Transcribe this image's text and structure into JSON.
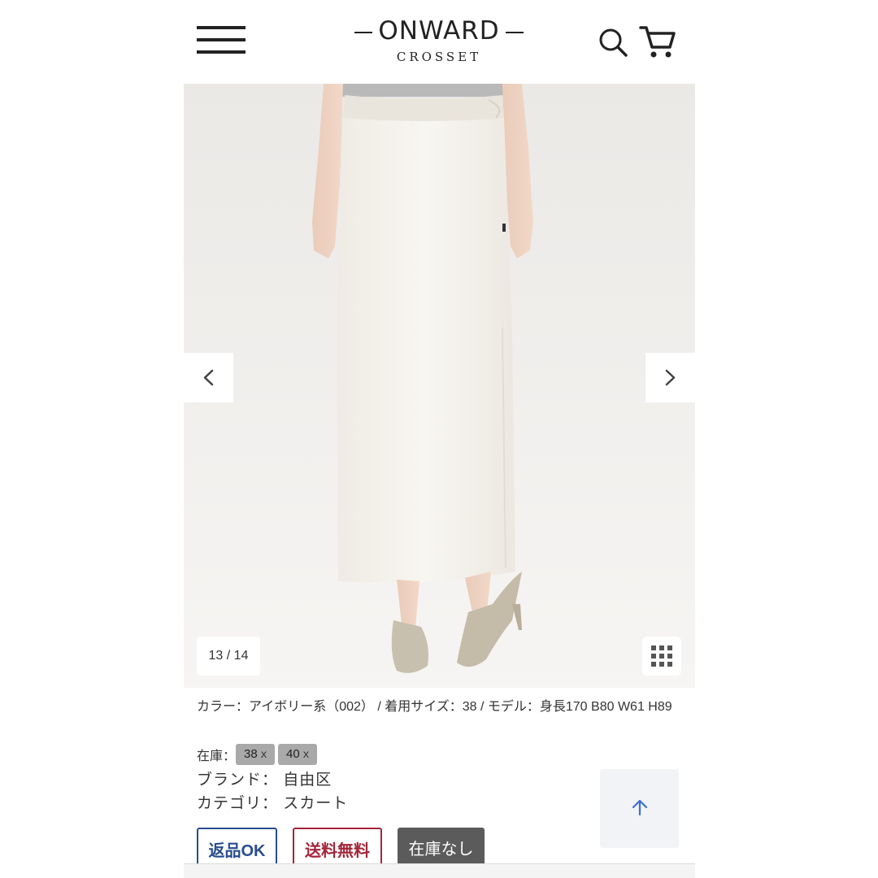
{
  "header": {
    "logo_main": "ONWARD",
    "logo_sub": "CROSSET",
    "menu_icon": "hamburger-menu-icon",
    "search_icon": "search-icon",
    "cart_icon": "cart-icon"
  },
  "gallery": {
    "counter": "13 / 14",
    "prev_icon": "chevron-left-icon",
    "next_icon": "chevron-right-icon",
    "grid_icon": "grid-icon",
    "image_desc": "product-photo"
  },
  "product": {
    "color_info": "カラー：アイボリー系（002）  /  着用サイズ：38  /  モデル：身長170 B80 W61 H89",
    "stock_label": "在庫：",
    "sizes": [
      {
        "size": "38",
        "mark": "X"
      },
      {
        "size": "40",
        "mark": "X"
      }
    ],
    "brand": "ブランド：  自由区",
    "category": "カテゴリ：  スカート"
  },
  "badges": {
    "returnable": "返品OK",
    "free_shipping": "送料無料",
    "out_of_stock": "在庫なし"
  },
  "colors": {
    "return_blue": "#2a4d8f",
    "shipping_red": "#a3263a",
    "soldout_gray": "#5b5b5b",
    "chip_gray": "#a9a9a9",
    "photo_bg": "#f0eeeb"
  },
  "back_to_top_icon": "arrow-up-icon"
}
